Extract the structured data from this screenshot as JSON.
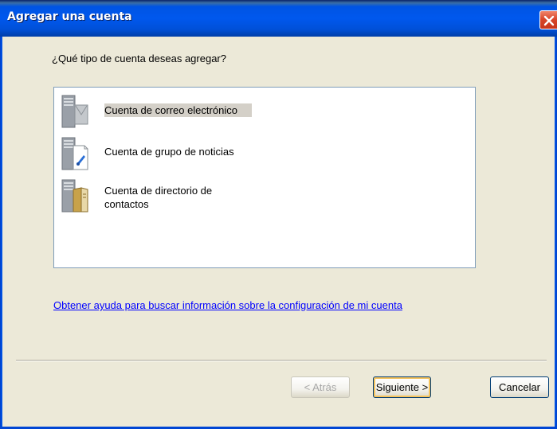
{
  "window": {
    "title": "Agregar una cuenta",
    "close_icon": "close-icon"
  },
  "dialog": {
    "question": "¿Qué tipo de cuenta deseas agregar?",
    "account_types": [
      {
        "label": "Cuenta de correo electrónico",
        "icon": "mail-server-icon",
        "selected": true
      },
      {
        "label": "Cuenta de grupo de noticias",
        "icon": "news-server-icon",
        "selected": false
      },
      {
        "label_line1": "Cuenta de directorio de",
        "label_line2": "contactos",
        "icon": "directory-server-icon",
        "selected": false
      }
    ],
    "help_link": "Obtener ayuda para buscar información sobre la configuración de mi cuenta"
  },
  "buttons": {
    "back": "< Atrás",
    "next": "Siguiente >",
    "cancel": "Cancelar"
  },
  "colors": {
    "titlebar": "#0058ee",
    "background": "#ece9d8",
    "link": "#0000ff",
    "selection": "#d4d0c8"
  }
}
